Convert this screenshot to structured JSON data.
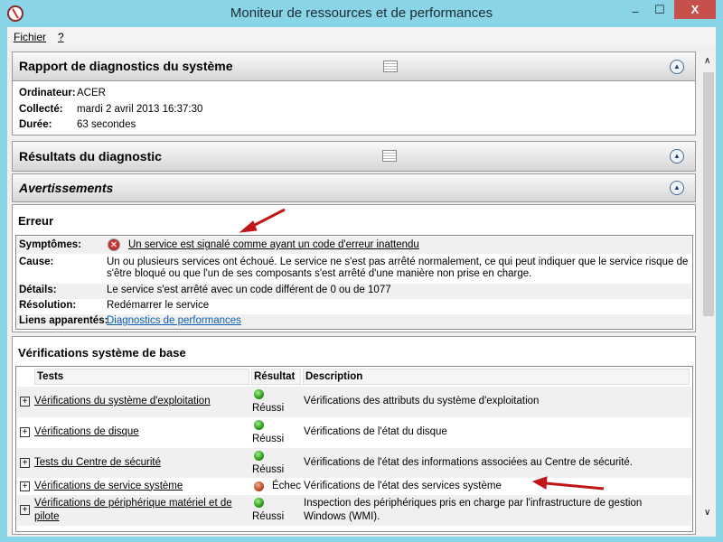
{
  "window": {
    "title": "Moniteur de ressources et de performances",
    "minimize": "–",
    "maximize": "☐",
    "close": "X"
  },
  "menu": {
    "file": "Fichier",
    "help": "?"
  },
  "report": {
    "title": "Rapport de diagnostics du système",
    "fields": [
      {
        "label": "Ordinateur:",
        "value": "ACER"
      },
      {
        "label": "Collecté:",
        "value": "mardi 2 avril 2013 16:37:30"
      },
      {
        "label": "Durée:",
        "value": "63 secondes"
      }
    ]
  },
  "results": {
    "title": "Résultats du diagnostic"
  },
  "warnings": {
    "title": "Avertissements"
  },
  "error": {
    "title": "Erreur",
    "symptoms_label": "Symptômes:",
    "symptoms": "Un service est signalé comme ayant un code d'erreur inattendu",
    "cause_label": "Cause:",
    "cause_line1": "Un ou plusieurs services ont échoué. Le service ne s'est pas arrêté normalement, ce qui peut indiquer que le service risque de",
    "cause_line2": "s'être bloqué ou que l'un de ses composants s'est arrêté d'une manière non prise en charge.",
    "details_label": "Détails:",
    "details": "Le service s'est arrêté avec un code différent de 0 ou de 1077",
    "resolution_label": "Résolution:",
    "resolution": "Redémarrer le service",
    "links_label": "Liens apparentés:",
    "links": "Diagnostics de performances"
  },
  "checks": {
    "title": "Vérifications système de base",
    "columns": [
      "Tests",
      "Résultat",
      "Description"
    ],
    "rows": [
      {
        "test": "Vérifications du système d'exploitation",
        "result": "Réussi",
        "status": "ok",
        "desc": "Vérifications des attributs du système d'exploitation"
      },
      {
        "test": "Vérifications de disque",
        "result": "Réussi",
        "status": "ok",
        "desc": "Vérifications de l'état du disque"
      },
      {
        "test": "Tests du Centre de sécurité",
        "result": "Réussi",
        "status": "ok",
        "desc": "Vérifications de l'état des informations associées au Centre de sécurité."
      },
      {
        "test": "Vérifications de service système",
        "result": "Échec",
        "status": "fail",
        "desc": "Vérifications de l'état des services système"
      },
      {
        "test": "Vérifications de périphérique matériel et de pilote",
        "result": "Réussi",
        "status": "ok",
        "desc": "Inspection des périphériques pris en charge par l'infrastructure de gestion Windows (WMI)."
      }
    ]
  }
}
